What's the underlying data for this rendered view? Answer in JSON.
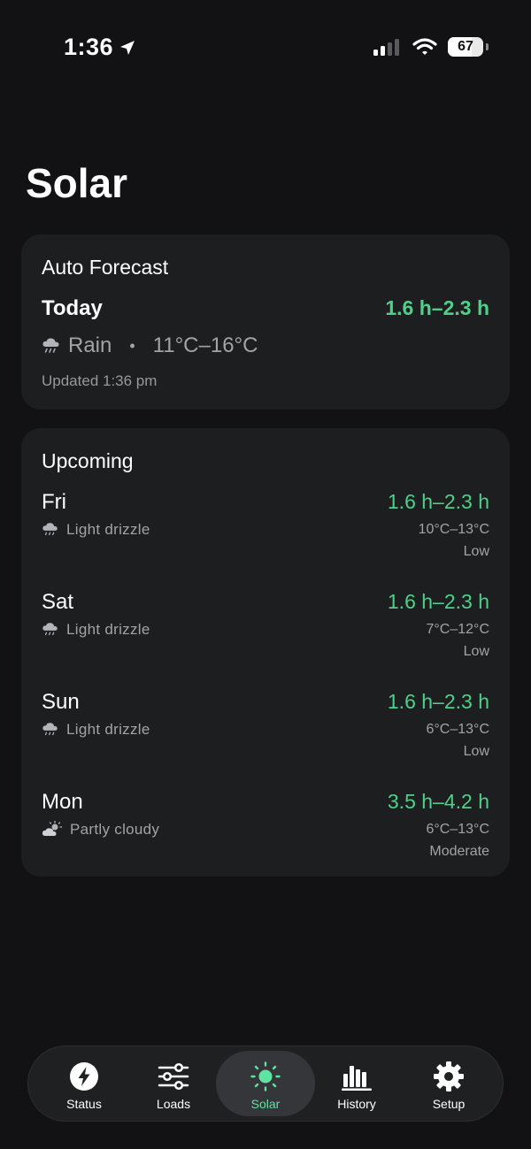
{
  "status_bar": {
    "time": "1:36",
    "battery": "67",
    "battery_level_percent": 67
  },
  "page": {
    "title": "Solar"
  },
  "auto_forecast": {
    "title": "Auto Forecast",
    "today_label": "Today",
    "hours": "1.6 h–2.3 h",
    "condition_icon": "rain-cloud-icon",
    "condition": "Rain",
    "separator": "•",
    "temp_range": "11°C–16°C",
    "updated": "Updated 1:36 pm"
  },
  "upcoming": {
    "title": "Upcoming",
    "days": [
      {
        "name": "Fri",
        "condition": "Light drizzle",
        "icon": "drizzle-cloud-icon",
        "hours": "1.6 h–2.3 h",
        "temp": "10°C–13°C",
        "level": "Low"
      },
      {
        "name": "Sat",
        "condition": "Light drizzle",
        "icon": "drizzle-cloud-icon",
        "hours": "1.6 h–2.3 h",
        "temp": "7°C–12°C",
        "level": "Low"
      },
      {
        "name": "Sun",
        "condition": "Light drizzle",
        "icon": "drizzle-cloud-icon",
        "hours": "1.6 h–2.3 h",
        "temp": "6°C–13°C",
        "level": "Low"
      },
      {
        "name": "Mon",
        "condition": "Partly cloudy",
        "icon": "partly-cloudy-icon",
        "hours": "3.5 h–4.2 h",
        "temp": "6°C–13°C",
        "level": "Moderate"
      }
    ]
  },
  "tab_bar": {
    "active": "Solar",
    "tabs": [
      {
        "label": "Status",
        "icon": "bolt-icon"
      },
      {
        "label": "Loads",
        "icon": "sliders-icon"
      },
      {
        "label": "Solar",
        "icon": "sun-icon"
      },
      {
        "label": "History",
        "icon": "bar-chart-icon"
      },
      {
        "label": "Setup",
        "icon": "gear-icon"
      }
    ]
  },
  "colors": {
    "background": "#121214",
    "card": "#1d1e20",
    "accent_green": "#4fd08a",
    "active_tab_green": "#5ee3a1",
    "secondary_text": "#a3a3a7"
  }
}
